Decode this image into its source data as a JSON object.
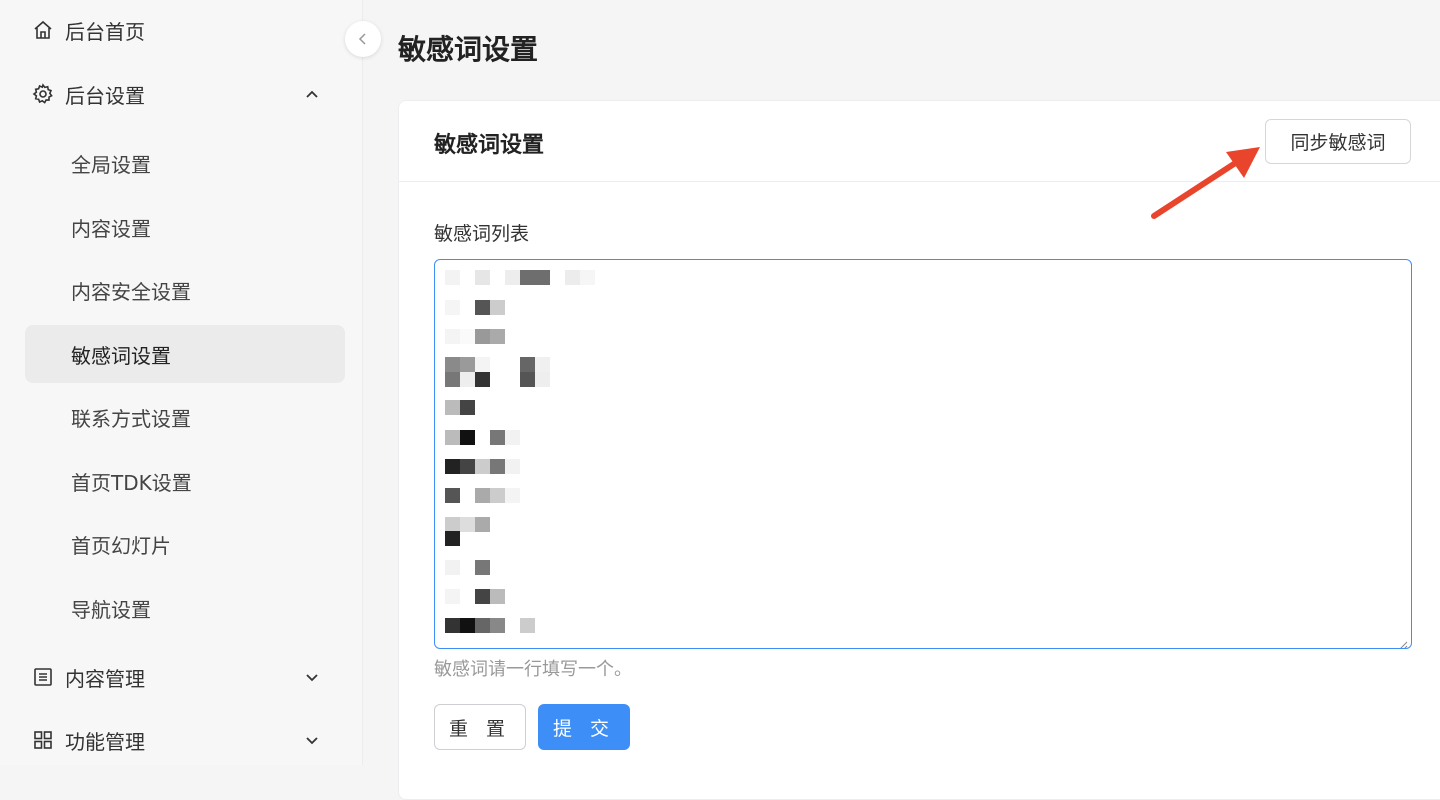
{
  "sidebar": {
    "items": [
      {
        "label": "后台首页",
        "icon": "home-icon"
      },
      {
        "label": "后台设置",
        "icon": "gear-icon",
        "expanded": true
      },
      {
        "label": "全局设置"
      },
      {
        "label": "内容设置"
      },
      {
        "label": "内容安全设置"
      },
      {
        "label": "敏感词设置",
        "active": true
      },
      {
        "label": "联系方式设置"
      },
      {
        "label": "首页TDK设置"
      },
      {
        "label": "首页幻灯片"
      },
      {
        "label": "导航设置"
      },
      {
        "label": "内容管理",
        "icon": "list-icon",
        "expanded": false
      },
      {
        "label": "功能管理",
        "icon": "grid-icon",
        "expanded": false
      }
    ]
  },
  "page": {
    "title": "敏感词设置"
  },
  "card": {
    "title": "敏感词设置",
    "sync_button": "同步敏感词",
    "field_label": "敏感词列表",
    "hint": "敏感词请一行填写一个。",
    "reset_button": "重 置",
    "submit_button": "提 交"
  },
  "colors": {
    "primary": "#3e8ef7",
    "annotation_arrow": "#e8452c",
    "active_nav_bg": "#ebebec"
  }
}
